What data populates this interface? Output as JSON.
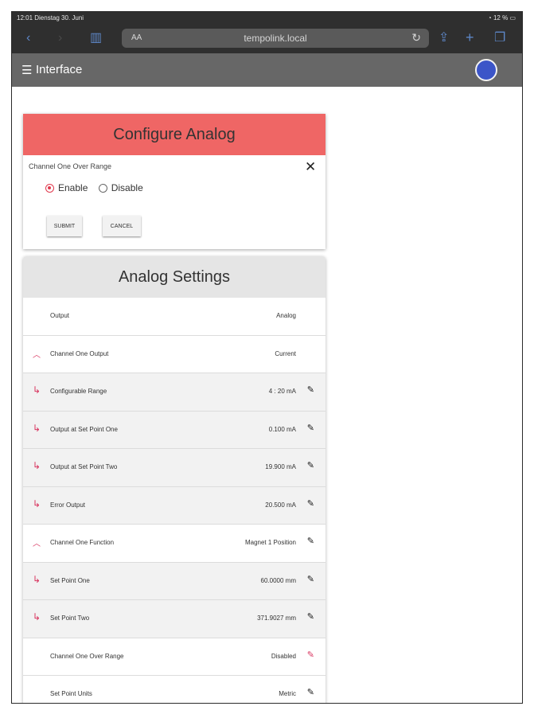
{
  "status_bar": {
    "time_date": "12:01  Dienstag 30. Juni",
    "battery": "12 %"
  },
  "browser": {
    "text_size_label": "AA",
    "url": "tempolink.local"
  },
  "app_bar": {
    "title": "Interface"
  },
  "configure": {
    "title": "Configure Analog",
    "field_label": "Channel One Over Range",
    "options": [
      "Enable",
      "Disable"
    ],
    "selected": "Enable",
    "submit_label": "SUBMIT",
    "cancel_label": "CANCEL"
  },
  "settings": {
    "title": "Analog Settings",
    "rows": [
      {
        "label": "Output",
        "value": "Analog",
        "icon": "",
        "editable": false
      },
      {
        "label": "Channel One Output",
        "value": "Current",
        "icon": "chevron-up",
        "editable": false
      },
      {
        "label": "Configurable Range",
        "value": "4 : 20 mA",
        "icon": "sub-arrow",
        "editable": true
      },
      {
        "label": "Output at Set Point One",
        "value": "0.100 mA",
        "icon": "sub-arrow",
        "editable": true
      },
      {
        "label": "Output at Set Point Two",
        "value": "19.900 mA",
        "icon": "sub-arrow",
        "editable": true
      },
      {
        "label": "Error Output",
        "value": "20.500 mA",
        "icon": "sub-arrow",
        "editable": true
      },
      {
        "label": "Channel One Function",
        "value": "Magnet 1 Position",
        "icon": "chevron-up",
        "editable": true
      },
      {
        "label": "Set Point One",
        "value": "60.0000 mm",
        "icon": "sub-arrow",
        "editable": true
      },
      {
        "label": "Set Point Two",
        "value": "371.9027 mm",
        "icon": "sub-arrow",
        "editable": true
      },
      {
        "label": "Channel One Over Range",
        "value": "Disabled",
        "icon": "",
        "editable": true
      },
      {
        "label": "Set Point Units",
        "value": "Metric",
        "icon": "",
        "editable": true
      }
    ]
  },
  "colors": {
    "accent": "#ef6665",
    "toolbar": "#676767",
    "avatar": "#3c55c8",
    "icon_red": "#d8345f"
  }
}
